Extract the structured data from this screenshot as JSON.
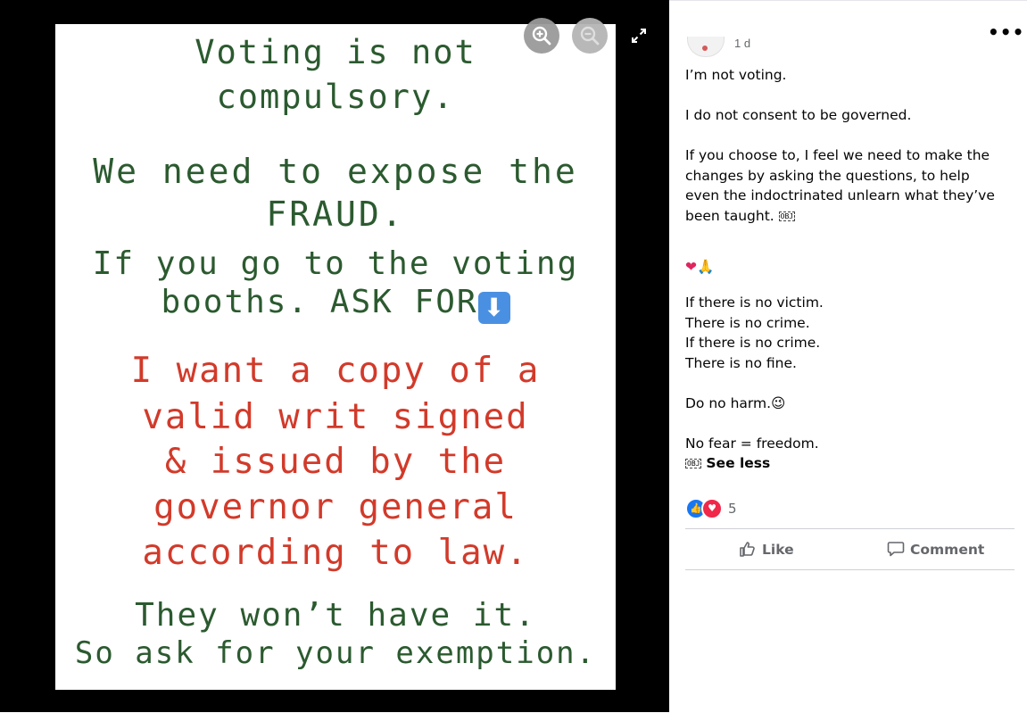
{
  "poster": {
    "line1": "Voting is not",
    "line2": "compulsory.",
    "line3": "We need to expose the",
    "line4": "FRAUD.",
    "line5": "If you go to the voting",
    "line6": "booths. ASK FOR",
    "line7": "I want a copy of a",
    "line8": "valid writ signed",
    "line9": "& issued by the",
    "line10": "governor general",
    "line11": "according to law.",
    "line12": "They won’t have it.",
    "line13": "So ask for your exemption.",
    "down_arrow_glyph": "⬇"
  },
  "viewer_controls": {
    "zoom_in_icon": "zoom-in-icon",
    "zoom_out_icon": "zoom-out-icon",
    "fullscreen_icon": "fullscreen-icon"
  },
  "post": {
    "time_fragment": "1 d",
    "more_glyph": "•••",
    "paragraphs": {
      "p1": "I’m not voting.",
      "p2": "I do not consent to be governed.",
      "p3": "If you choose to, I feel we need to make the changes by asking the questions, to help even the indoctrinated unlearn what they’ve been taught.",
      "obj": "OBJ",
      "emoji_line": "❤🙏",
      "p5a": "If there is no victim.",
      "p5b": "There is no crime.",
      "p5c": "If there is no crime.",
      "p5d": "There is no fine.",
      "p6": "Do no harm.",
      "wink": "😉",
      "p7": "No fear = freedom.",
      "see_less": "See less"
    },
    "reactions": {
      "like_glyph": "👍",
      "love_glyph": "♥",
      "count": "5"
    },
    "actions": {
      "like_label": "Like",
      "comment_label": "Comment"
    }
  },
  "colors": {
    "poster_green": "#2b5a2f",
    "poster_red": "#d23a2a",
    "facebook_blue": "#1877f2",
    "love_red": "#f02849"
  }
}
